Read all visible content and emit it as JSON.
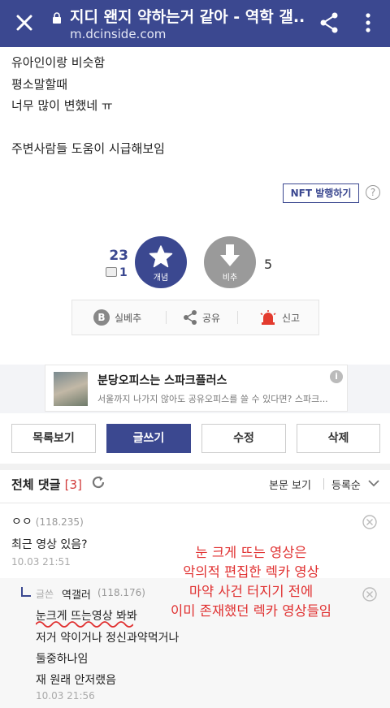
{
  "browser": {
    "title": "지디 왠지 약하는거 같아 - 역학 갤...",
    "url": "m.dcinside.com"
  },
  "post": {
    "lines": [
      "유아인이랑 비슷함",
      "평소말할때",
      "너무 많이 변했네 ㅠ",
      "",
      "주변사람들 도움이 시급해보임"
    ],
    "nft_label": "NFT 발행하기",
    "help_icon": "?",
    "upvotes": "23",
    "fixed_upvotes": "1",
    "upvote_label": "개념",
    "downvote_label": "비추",
    "downvotes": "5"
  },
  "actions": {
    "realtime_label": "실베추",
    "share_label": "공유",
    "report_label": "신고",
    "realtime_icon_letter": "B"
  },
  "ad": {
    "title": "분당오피스는 스파크플러스",
    "description": "서울까지 나가지 않아도 공유오피스를 쓸 수 있다면? 스파크...",
    "info_icon": "i"
  },
  "buttons": {
    "list": "목록보기",
    "write": "글쓰기",
    "edit": "수정",
    "delete": "삭제"
  },
  "comments_header": {
    "title": "전체 댓글",
    "count": "[3]",
    "view_body": "본문 보기",
    "sort": "등록순"
  },
  "comments": [
    {
      "nick": "ㅇㅇ",
      "ip": "(118.235)",
      "text": "최근 영상 있음?",
      "date": "10.03 21:51"
    }
  ],
  "reply": {
    "label": "글쓴",
    "nick": "역갤러",
    "ip": "(118.176)",
    "lines": [
      "눈크게 뜨는영상 봐봐",
      "저거 약이거나 정신과약먹거나",
      "둘중하나임",
      "재 원래 안저랬음"
    ],
    "date": "10.03 21:56"
  },
  "overlay_text": [
    "눈 크게 뜨는 영상은",
    "악의적 편집한 렉카 영상",
    "마약 사건 터지기 전에",
    "이미 존재했던 렉카 영상들임"
  ],
  "colors": {
    "brand": "#3b4890",
    "report": "#e33b2e",
    "overlay": "#e03030"
  }
}
